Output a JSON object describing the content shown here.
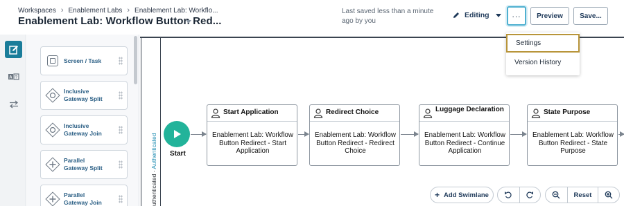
{
  "header": {
    "breadcrumb": [
      "Workspaces",
      "Enablement Labs",
      "Enablement Lab: Workflo..."
    ],
    "title": "Enablement Lab: Workflow Button Red...",
    "saved_status": "Last saved less than a minute ago by you",
    "mode_label": "Editing",
    "more_label": "...",
    "preview_label": "Preview",
    "save_label": "Save..."
  },
  "menu": {
    "items": [
      "Settings",
      "Version History"
    ]
  },
  "palette": {
    "items": [
      {
        "label": "Screen / Task",
        "icon": "square-icon"
      },
      {
        "label": "Inclusive\nGateway Split",
        "icon": "inclusive-gateway-icon"
      },
      {
        "label": "Inclusive\nGateway Join",
        "icon": "inclusive-gateway-icon"
      },
      {
        "label": "Parallel\nGateway Split",
        "icon": "parallel-gateway-icon"
      },
      {
        "label": "Parallel\nGateway Join",
        "icon": "parallel-gateway-icon"
      }
    ]
  },
  "lane": {
    "label_prefix": "uthenticated",
    "label_suffix": "Authenticated"
  },
  "start": {
    "label": "Start"
  },
  "tasks": [
    {
      "title": "Start Application",
      "body": "Enablement Lab: Workflow Button Redirect - Start Application"
    },
    {
      "title": "Redirect Choice",
      "body": "Enablement Lab: Workflow Button Redirect - Redirect Choice"
    },
    {
      "title": "Luggage Declaration",
      "body": "Enablement Lab: Workflow Button Redirect - Continue Application"
    },
    {
      "title": "State Purpose",
      "body": "Enablement Lab: Workflow Button Redirect - State Purpose"
    }
  ],
  "controls": {
    "add_swimlane": "Add Swimlane",
    "reset": "Reset"
  },
  "colors": {
    "accent": "#1a7d9a",
    "start": "#22b39a",
    "menu_focus": "#b8953a",
    "link": "#2b5f85"
  }
}
